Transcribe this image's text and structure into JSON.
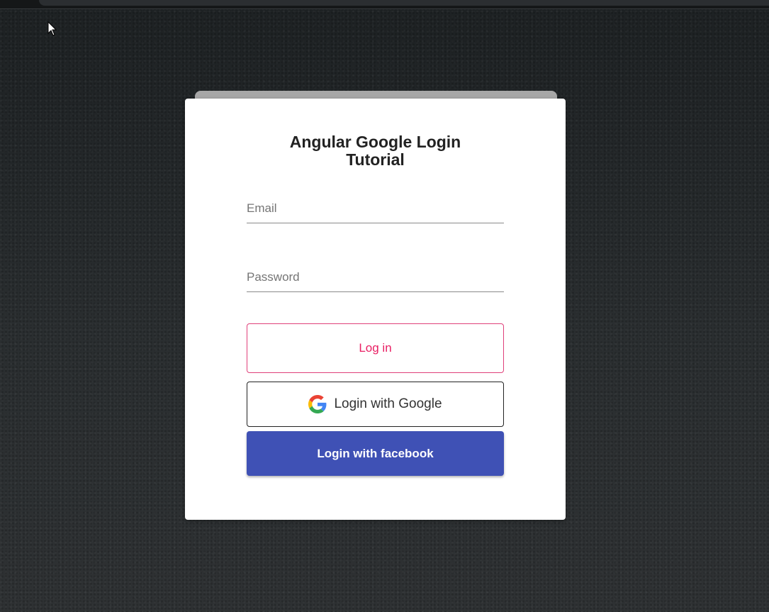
{
  "login_card": {
    "title_line1": "Angular Google Login",
    "title_line2": "Tutorial",
    "email_placeholder": "Email",
    "password_placeholder": "Password",
    "login_button_label": "Log in",
    "google_button_label": "Login with Google",
    "facebook_button_label": "Login with facebook"
  },
  "colors": {
    "login_accent": "#e91e63",
    "facebook_blue": "#3f51b5",
    "card_background": "#ffffff",
    "page_background": "#262a2c"
  },
  "icons": {
    "google": "google-g-logo",
    "cursor": "mouse-pointer"
  }
}
